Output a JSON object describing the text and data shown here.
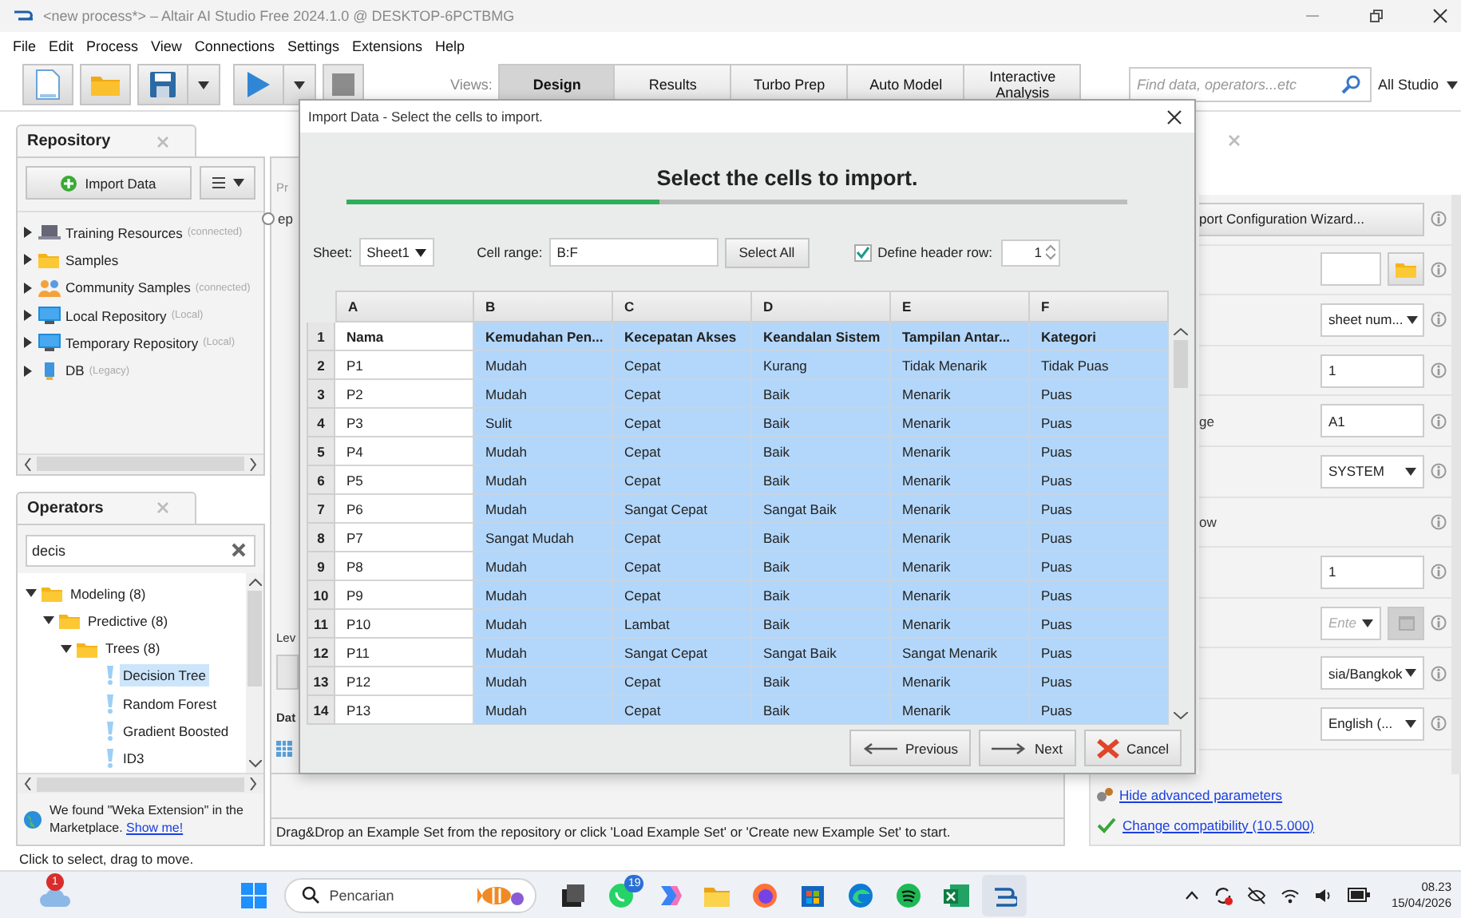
{
  "window": {
    "title": "<new process*> – Altair AI Studio Free 2024.1.0 @ DESKTOP-6PCTBMG"
  },
  "menu": [
    "File",
    "Edit",
    "Process",
    "View",
    "Connections",
    "Settings",
    "Extensions",
    "Help"
  ],
  "toolbar": {
    "views_label": "Views:",
    "views": [
      {
        "label": "Design",
        "selected": true
      },
      {
        "label": "Results",
        "selected": false
      },
      {
        "label": "Turbo Prep",
        "selected": false
      },
      {
        "label": "Auto Model",
        "selected": false
      },
      {
        "label": "Interactive Analysis",
        "selected": false
      }
    ],
    "search": {
      "placeholder": "Find data, operators...etc"
    },
    "scope": "All Studio"
  },
  "repository": {
    "title": "Repository",
    "import_button": "Import Data",
    "items": [
      {
        "label": "Training Resources",
        "note": "(connected)",
        "kind": "training",
        "expanded": false
      },
      {
        "label": "Samples",
        "kind": "folder",
        "expanded": false
      },
      {
        "label": "Community Samples",
        "note": "(connected)",
        "kind": "community",
        "expanded": false
      },
      {
        "label": "Local Repository",
        "note": "(Local)",
        "kind": "local",
        "expanded": false
      },
      {
        "label": "Temporary Repository",
        "note": "(Local)",
        "kind": "local",
        "expanded": false
      },
      {
        "label": "DB",
        "note": "(Legacy)",
        "kind": "db",
        "expanded": false
      }
    ]
  },
  "operators": {
    "title": "Operators",
    "search": {
      "value": "decis"
    },
    "tree": [
      {
        "label": "Modeling (8)",
        "expanded": true,
        "children": [
          {
            "label": "Predictive (8)",
            "expanded": true,
            "children": [
              {
                "label": "Trees (8)",
                "expanded": true,
                "children": [
                  {
                    "label": "Decision Tree",
                    "selected": true
                  },
                  {
                    "label": "Random Forest",
                    "selected": false
                  },
                  {
                    "label": "Gradient Boosted",
                    "selected": false
                  },
                  {
                    "label": "ID3",
                    "selected": false
                  }
                ]
              }
            ]
          }
        ]
      }
    ],
    "marketplace": {
      "text": "We found \"Weka Extension\" in the Marketplace.",
      "link": "Show me!"
    }
  },
  "process_panel": {
    "label_1": "Pr",
    "option": {
      "label": "ep",
      "selected": false
    },
    "label_2": "Lev",
    "tab": "Dat",
    "hint": "Drag&Drop an Example Set from the repository or click 'Load Example Set' or 'Create new Example Set' to start."
  },
  "parameters": {
    "rows": [
      {
        "kind": "wizard",
        "value": "port Configuration Wizard..."
      },
      {
        "kind": "file"
      },
      {
        "kind": "select",
        "value": "sheet num..."
      },
      {
        "kind": "text",
        "value": "1"
      },
      {
        "kind": "text",
        "label": "ge",
        "value": "A1"
      },
      {
        "kind": "select",
        "value": "SYSTEM"
      },
      {
        "kind": "label",
        "label": "ow"
      },
      {
        "kind": "text",
        "value": "1"
      },
      {
        "kind": "date",
        "placeholder": "Ente"
      },
      {
        "kind": "select",
        "value": "sia/Bangkok"
      },
      {
        "kind": "select",
        "value": "English (..."
      }
    ],
    "advanced_link": "Hide advanced parameters",
    "compatibility_link": "Change compatibility (10.5.000)"
  },
  "dialog": {
    "title": "Import Data - Select the cells to import.",
    "heading": "Select the cells to import.",
    "progress": {
      "level": 0.4
    },
    "sheet_label": "Sheet:",
    "sheet": "Sheet1",
    "range_label": "Cell range:",
    "range": "B:F",
    "select_all": "Select All",
    "header_check": {
      "label": "Define header row:",
      "checked": true
    },
    "header_row": "1",
    "table": {
      "columns": [
        {
          "label": "A",
          "selected": false
        },
        {
          "label": "B",
          "selected": true
        },
        {
          "label": "C",
          "selected": true
        },
        {
          "label": "D",
          "selected": true
        },
        {
          "label": "E",
          "selected": true
        },
        {
          "label": "F",
          "selected": true
        }
      ],
      "rows": [
        {
          "number": "1",
          "header": true,
          "cells": [
            "Nama",
            "Kemudahan Pen...",
            "Kecepatan Akses",
            "Keandalan Sistem",
            "Tampilan Antar...",
            "Kategori"
          ]
        },
        {
          "number": "2",
          "header": false,
          "cells": [
            "P1",
            "Mudah",
            "Cepat",
            "Kurang",
            "Tidak Menarik",
            "Tidak Puas"
          ]
        },
        {
          "number": "3",
          "header": false,
          "cells": [
            "P2",
            "Mudah",
            "Cepat",
            "Baik",
            "Menarik",
            "Puas"
          ]
        },
        {
          "number": "4",
          "header": false,
          "cells": [
            "P3",
            "Sulit",
            "Cepat",
            "Baik",
            "Menarik",
            "Puas"
          ]
        },
        {
          "number": "5",
          "header": false,
          "cells": [
            "P4",
            "Mudah",
            "Cepat",
            "Baik",
            "Menarik",
            "Puas"
          ]
        },
        {
          "number": "6",
          "header": false,
          "cells": [
            "P5",
            "Mudah",
            "Cepat",
            "Baik",
            "Menarik",
            "Puas"
          ]
        },
        {
          "number": "7",
          "header": false,
          "cells": [
            "P6",
            "Mudah",
            "Sangat Cepat",
            "Sangat Baik",
            "Menarik",
            "Puas"
          ]
        },
        {
          "number": "8",
          "header": false,
          "cells": [
            "P7",
            "Sangat Mudah",
            "Cepat",
            "Baik",
            "Menarik",
            "Puas"
          ]
        },
        {
          "number": "9",
          "header": false,
          "cells": [
            "P8",
            "Mudah",
            "Cepat",
            "Baik",
            "Menarik",
            "Puas"
          ]
        },
        {
          "number": "10",
          "header": false,
          "cells": [
            "P9",
            "Mudah",
            "Cepat",
            "Baik",
            "Menarik",
            "Puas"
          ]
        },
        {
          "number": "11",
          "header": false,
          "cells": [
            "P10",
            "Mudah",
            "Lambat",
            "Baik",
            "Menarik",
            "Puas"
          ]
        },
        {
          "number": "12",
          "header": false,
          "cells": [
            "P11",
            "Mudah",
            "Sangat Cepat",
            "Sangat Baik",
            "Sangat Menarik",
            "Puas"
          ]
        },
        {
          "number": "13",
          "header": false,
          "cells": [
            "P12",
            "Mudah",
            "Cepat",
            "Baik",
            "Menarik",
            "Puas"
          ]
        },
        {
          "number": "14",
          "header": false,
          "cells": [
            "P13",
            "Mudah",
            "Cepat",
            "Baik",
            "Menarik",
            "Puas"
          ]
        }
      ]
    },
    "buttons": [
      {
        "kind": "previous",
        "label": "Previous"
      },
      {
        "kind": "next",
        "label": "Next"
      },
      {
        "kind": "cancel",
        "label": "Cancel"
      }
    ]
  },
  "status_bar": "Click to select, drag to move.",
  "taskbar": {
    "weather_badge": "1",
    "search_placeholder": "Pencarian",
    "apps": [
      {
        "kind": "taskview",
        "selected": false
      },
      {
        "kind": "chat",
        "badge": "19",
        "selected": false
      },
      {
        "kind": "sparkle",
        "selected": false
      },
      {
        "kind": "folder",
        "selected": false
      },
      {
        "kind": "fox",
        "selected": false
      },
      {
        "kind": "store",
        "selected": false
      },
      {
        "kind": "edge",
        "selected": false
      },
      {
        "kind": "music",
        "selected": false
      },
      {
        "kind": "sheet",
        "selected": false
      },
      {
        "kind": "altair",
        "selected": true
      }
    ],
    "time": "08.23",
    "date": "15/04/2026"
  }
}
